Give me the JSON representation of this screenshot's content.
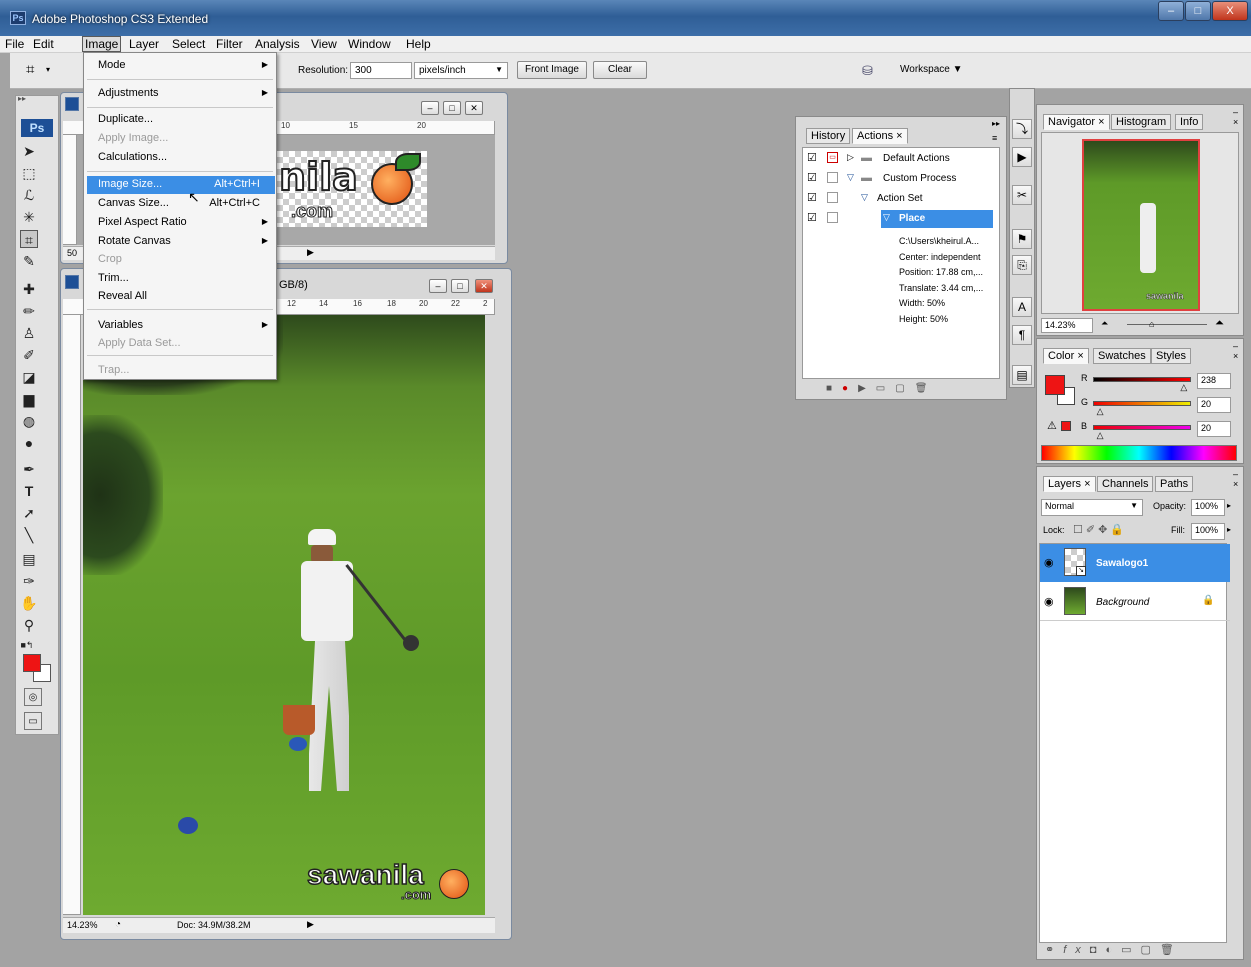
{
  "window": {
    "title": "Adobe Photoshop CS3 Extended",
    "minimize": "–",
    "maximize": "□",
    "close": "X"
  },
  "menubar": {
    "items": [
      "File",
      "Edit",
      "Image",
      "Layer",
      "Select",
      "Filter",
      "Analysis",
      "View",
      "Window",
      "Help"
    ]
  },
  "options": {
    "resolution_label": "Resolution:",
    "resolution_value": "300",
    "unit": "pixels/inch",
    "front_image": "Front Image",
    "clear": "Clear",
    "workspace": "Workspace ▼"
  },
  "image_menu": {
    "items": [
      {
        "label": "Mode",
        "submenu": true
      },
      {
        "label": "Adjustments",
        "submenu": true
      },
      {
        "label": "Duplicate..."
      },
      {
        "label": "Apply Image...",
        "disabled": true
      },
      {
        "label": "Calculations..."
      },
      {
        "label": "Image Size...",
        "shortcut": "Alt+Ctrl+I",
        "highlighted": true
      },
      {
        "label": "Canvas Size...",
        "shortcut": "Alt+Ctrl+C"
      },
      {
        "label": "Pixel Aspect Ratio",
        "submenu": true
      },
      {
        "label": "Rotate Canvas",
        "submenu": true
      },
      {
        "label": "Crop",
        "disabled": true
      },
      {
        "label": "Trim..."
      },
      {
        "label": "Reveal All"
      },
      {
        "label": "Variables",
        "submenu": true
      },
      {
        "label": "Apply Data Set...",
        "disabled": true
      },
      {
        "label": "Trap...",
        "disabled": true
      }
    ]
  },
  "doc1": {
    "zoom": "50",
    "ruler": [
      "10",
      "15",
      "20"
    ],
    "logo_text": "nila",
    "logo_com": ".com"
  },
  "doc2": {
    "title_suffix": "GB/8)",
    "zoom": "14.23%",
    "doc_info": "Doc: 34.9M/38.2M",
    "ruler": [
      "12",
      "14",
      "16",
      "18",
      "20",
      "22",
      "2"
    ],
    "watermark": "sawanila",
    "watermark_com": ".com"
  },
  "actions_panel": {
    "tabs": [
      "History",
      "Actions ×"
    ],
    "rows": [
      {
        "label": "Default Actions",
        "level": 0,
        "type": "set",
        "check": true,
        "dialog": true
      },
      {
        "label": "Custom Process",
        "level": 0,
        "type": "set-open",
        "check": true
      },
      {
        "label": "Action Set",
        "level": 1,
        "type": "action",
        "check": true
      },
      {
        "label": "Place",
        "level": 2,
        "type": "step",
        "check": true,
        "selected": true
      },
      {
        "label": "C:\\Users\\kheirul.A...",
        "level": 3
      },
      {
        "label": "Center: independent",
        "level": 3
      },
      {
        "label": "Position: 17.88 cm,...",
        "level": 3
      },
      {
        "label": "Translate: 3.44 cm,...",
        "level": 3
      },
      {
        "label": "Width: 50%",
        "level": 3
      },
      {
        "label": "Height: 50%",
        "level": 3
      }
    ]
  },
  "navigator": {
    "tabs": [
      "Navigator ×",
      "Histogram",
      "Info"
    ],
    "zoom": "14.23%",
    "thumb_watermark": "sawanila"
  },
  "color_panel": {
    "tabs": [
      "Color ×",
      "Swatches",
      "Styles"
    ],
    "channels": [
      {
        "label": "R",
        "value": "238",
        "fraction": 0.933
      },
      {
        "label": "G",
        "value": "20",
        "fraction": 0.078
      },
      {
        "label": "B",
        "value": "20",
        "fraction": 0.078
      }
    ],
    "fg": "#ee1414"
  },
  "layers_panel": {
    "tabs": [
      "Layers ×",
      "Channels",
      "Paths"
    ],
    "blend": "Normal",
    "opacity_label": "Opacity:",
    "opacity": "100%",
    "lock_label": "Lock:",
    "fill_label": "Fill:",
    "fill": "100%",
    "layers": [
      {
        "name": "Sawalogo1",
        "selected": true
      },
      {
        "name": "Background",
        "locked": true
      }
    ]
  },
  "colors": {
    "accent": "#3b8ee5",
    "foreground": "#ee1414"
  }
}
